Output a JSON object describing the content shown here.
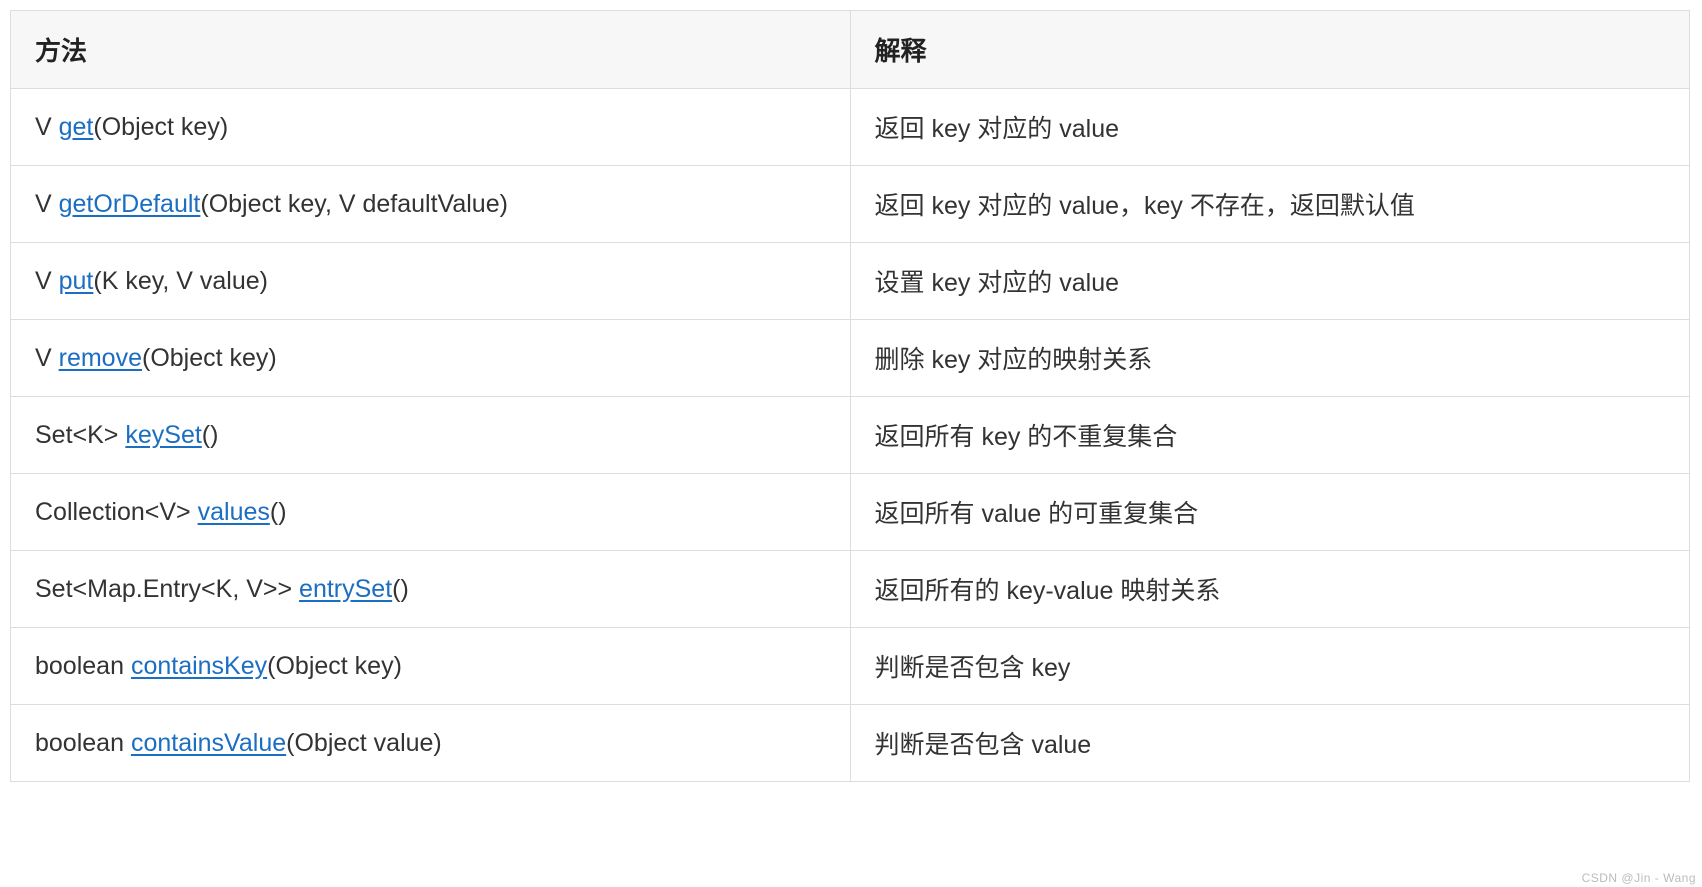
{
  "headers": {
    "method": "方法",
    "desc": "解释"
  },
  "rows": [
    {
      "prefix": "V ",
      "link": "get",
      "suffix": "(Object key)",
      "desc": "返回 key 对应的 value"
    },
    {
      "prefix": "V ",
      "link": "getOrDefault",
      "suffix": "(Object key, V defaultValue)",
      "desc": "返回 key 对应的 value，key 不存在，返回默认值"
    },
    {
      "prefix": "V ",
      "link": "put",
      "suffix": "(K key, V value)",
      "desc": "设置 key 对应的 value"
    },
    {
      "prefix": "V ",
      "link": "remove",
      "suffix": "(Object key)",
      "desc": "删除 key 对应的映射关系"
    },
    {
      "prefix": "Set<K> ",
      "link": "keySet",
      "suffix": "()",
      "desc": "返回所有 key 的不重复集合"
    },
    {
      "prefix": "Collection<V> ",
      "link": "values",
      "suffix": "()",
      "desc": "返回所有 value 的可重复集合"
    },
    {
      "prefix": "Set<Map.Entry<K, V>> ",
      "link": "entrySet",
      "suffix": "()",
      "desc": "返回所有的 key-value 映射关系"
    },
    {
      "prefix": "boolean ",
      "link": "containsKey",
      "suffix": "(Object key)",
      "desc": "判断是否包含 key"
    },
    {
      "prefix": "boolean ",
      "link": "containsValue",
      "suffix": "(Object value)",
      "desc": "判断是否包含 value"
    }
  ],
  "watermark": "CSDN @Jin - Wang"
}
